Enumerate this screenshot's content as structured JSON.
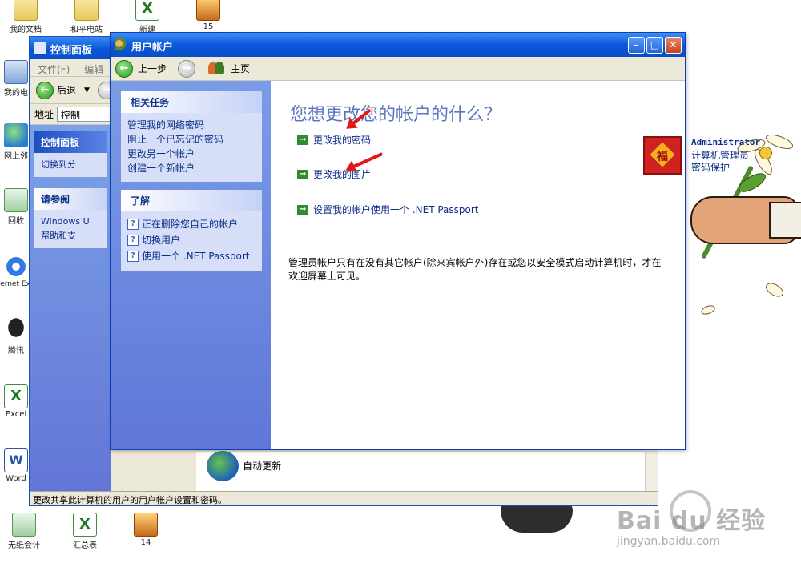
{
  "desktop": {
    "icons": [
      {
        "label": "我的文档"
      },
      {
        "label": "和平电站"
      },
      {
        "label": "新建"
      },
      {
        "label": "15"
      },
      {
        "label": "我的电"
      },
      {
        "label": "网上邻"
      },
      {
        "label": "回收"
      },
      {
        "label": "Internet Explo"
      },
      {
        "label": "腾讯"
      },
      {
        "label": "Excel"
      },
      {
        "label": "Word"
      },
      {
        "label": "无纸会计"
      },
      {
        "label": "汇总表"
      },
      {
        "label": "14"
      }
    ]
  },
  "watermark": {
    "logo": "Bai du 经验",
    "url": "jingyan.baidu.com"
  },
  "control_panel": {
    "title": "控制面板",
    "menu": [
      "文件(F)",
      "编辑"
    ],
    "back_label": "后退",
    "address_label": "地址",
    "address_value": "控制",
    "side_panel_title": "控制面板",
    "switch_label": "切换到分",
    "see_also_title": "请参阅",
    "see_also_items": [
      "Windows U",
      "帮助和支"
    ],
    "auto_update_label": "自动更新",
    "status_text": "更改共享此计算机的用户的用户帐户设置和密码。"
  },
  "user_accounts": {
    "title": "用户帐户",
    "nav": {
      "back_label": "上一步",
      "home_label": "主页"
    },
    "related_tasks": {
      "title": "相关任务",
      "links": [
        "管理我的网络密码",
        "阻止一个已忘记的密码",
        "更改另一个帐户",
        "创建一个新帐户"
      ]
    },
    "learn_about": {
      "title": "了解",
      "links": [
        "正在删除您自己的帐户",
        "切换用户",
        "使用一个 .NET Passport"
      ]
    },
    "heading": "您想更改您的帐户的什么？",
    "tasks": [
      "更改我的密码",
      "更改我的图片",
      "设置我的帐户使用一个 .NET Passport"
    ],
    "account": {
      "picture_char": "福",
      "name": "Administrator",
      "role": "计算机管理员",
      "protection": "密码保护"
    },
    "note": "管理员帐户只有在没有其它帐户(除来宾帐户外)存在或您以安全模式启动计算机时，才在欢迎屏幕上可见。"
  },
  "colors": {
    "titlebar": "#0a58da",
    "sidebar": "#6f8ce0",
    "link": "#0b2e8a",
    "heading": "#5b78bf",
    "task_arrow": "#2f8d2f",
    "annotation_arrow": "#e01818"
  }
}
